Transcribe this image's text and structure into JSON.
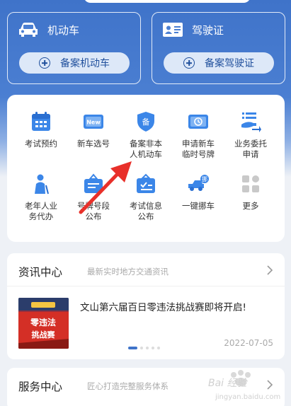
{
  "license_cards": {
    "vehicle": {
      "title": "机动车",
      "button": "备案机动车"
    },
    "driver": {
      "title": "驾驶证",
      "button": "备案驾驶证"
    }
  },
  "services": [
    {
      "label": "考试预约",
      "icon": "calendar-icon"
    },
    {
      "label": "新车选号",
      "icon": "new-plate-icon"
    },
    {
      "label": "备案非本\n人机动车",
      "icon": "shield-badge-icon"
    },
    {
      "label": "申请新车\n临时号牌",
      "icon": "temp-plate-icon"
    },
    {
      "label": "业务委托\n申请",
      "icon": "delegate-icon"
    },
    {
      "label": "老年人业\n务代办",
      "icon": "elderly-icon"
    },
    {
      "label": "号牌号段\n公布",
      "icon": "plate-segment-icon"
    },
    {
      "label": "考试信息\n公布",
      "icon": "exam-info-icon"
    },
    {
      "label": "一键挪车",
      "icon": "tow-car-icon"
    },
    {
      "label": "更多",
      "icon": "more-grid-icon"
    }
  ],
  "info_center": {
    "title": "资讯中心",
    "subtitle": "最新实时地方交通资讯",
    "news": {
      "title": "文山第六届百日零违法挑战赛即将开启!",
      "date": "2022-07-05",
      "thumb_text": "百日零违法 挑战赛"
    }
  },
  "service_center": {
    "title": "服务中心",
    "subtitle": "匠心打造完整服务体系"
  },
  "watermark": {
    "text": "Bai 经验",
    "url": "jingyan.baidu.com"
  },
  "colors": {
    "brand_blue": "#3f73c9",
    "icon_blue": "#3b86e8",
    "arrow_red": "#e8302a"
  }
}
